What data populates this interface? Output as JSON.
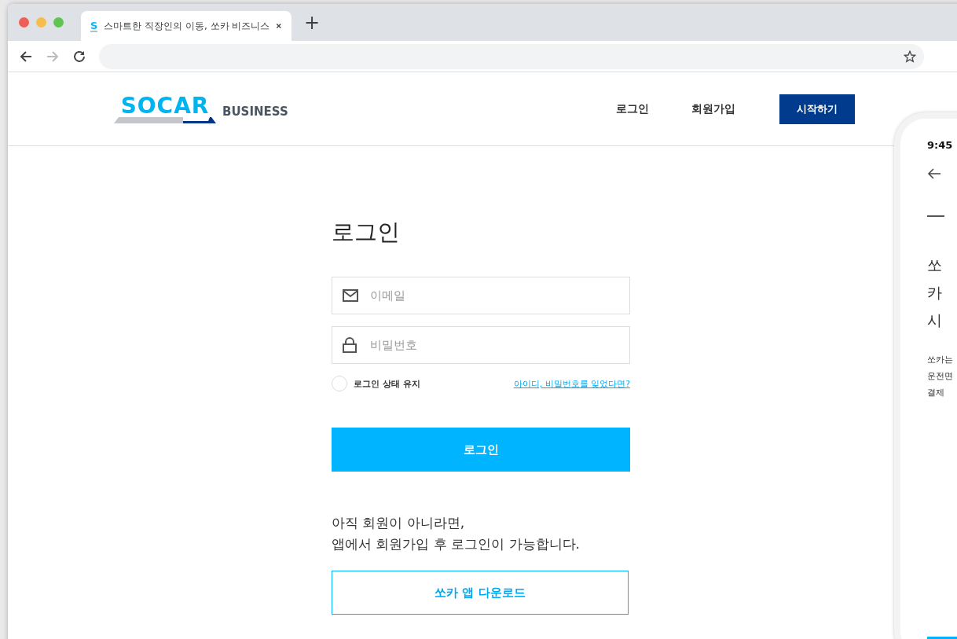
{
  "browser": {
    "tab_title": "스마트한 직장인의 이동, 쏘카 비즈니스",
    "favicon": "S",
    "new_tab": "+"
  },
  "header": {
    "logo": "SOCAR",
    "logo_suffix": "BUSINESS",
    "nav": [
      "로그인",
      "회원가입"
    ],
    "cta": "시작하기"
  },
  "login": {
    "title": "로그인",
    "fields": [
      {
        "kind": "email",
        "placeholder": "이메일"
      },
      {
        "kind": "password",
        "placeholder": "비밀번호"
      }
    ],
    "remember": {
      "label": "로그인 상태 유지",
      "checked": false
    },
    "forgot": "아이디, 비밀번호를 잊었다면?",
    "submit": "로그인",
    "notice": [
      "아직 회원이 아니라면,",
      "앱에서 회원가입 후 로그인이 가능합니다."
    ],
    "download": "쏘카 앱 다운로드"
  },
  "phone": {
    "time": "9:45",
    "heading": [
      "쏘",
      "카",
      "시"
    ],
    "body": [
      "쏘카는",
      "운전면",
      "결제"
    ]
  }
}
